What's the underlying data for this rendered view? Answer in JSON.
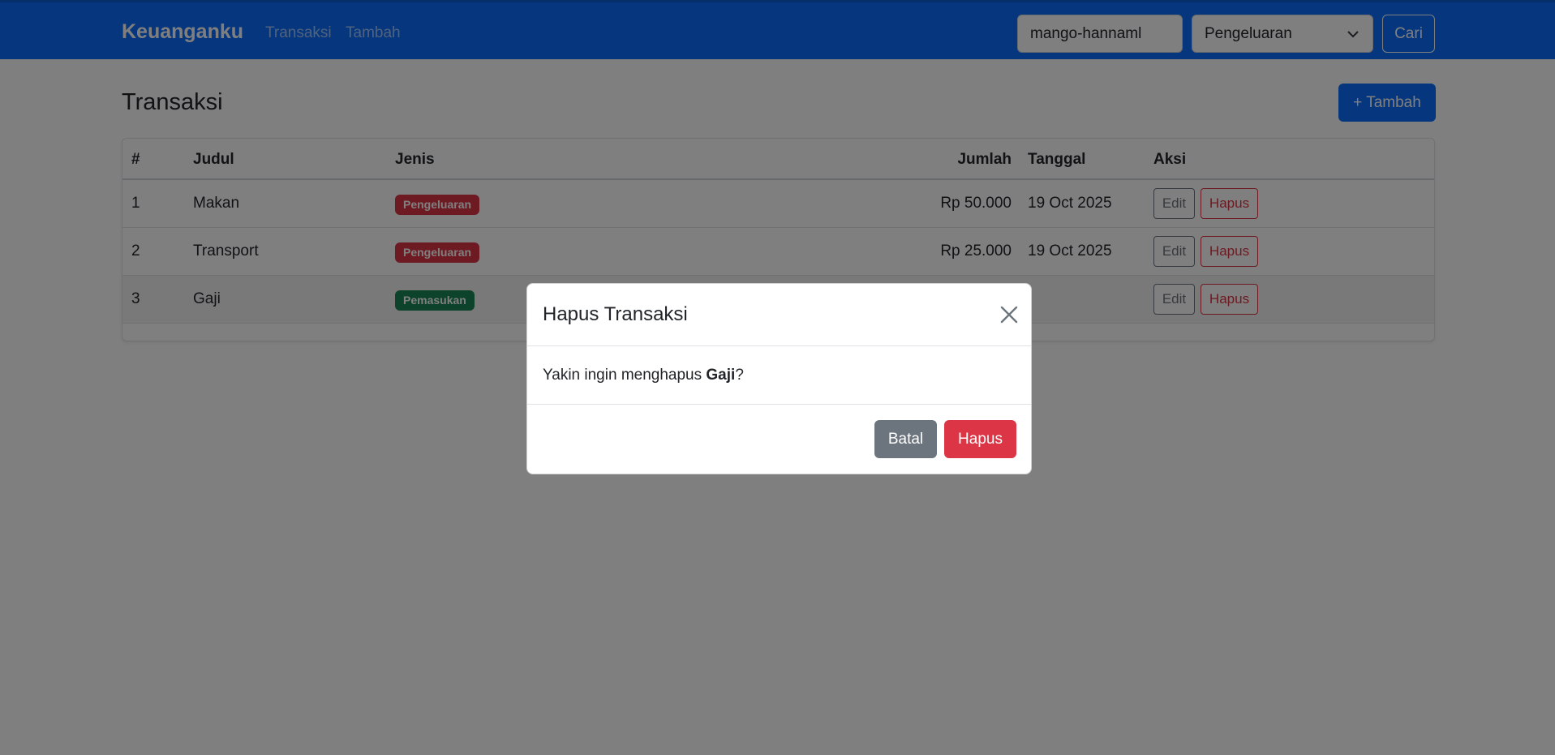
{
  "navbar": {
    "brand": "Keuanganku",
    "links": [
      "Transaksi",
      "Tambah"
    ],
    "search_value": "mango-hannaml",
    "filter_selected": "Pengeluaran",
    "search_button": "Cari",
    "chevron_icon": "chevron-down-icon"
  },
  "page": {
    "title": "Transaksi",
    "add_button": "+ Tambah"
  },
  "table": {
    "headers": [
      "#",
      "Judul",
      "Jenis",
      "Jumlah",
      "Tanggal",
      "Aksi"
    ],
    "rows": [
      {
        "no": "1",
        "judul": "Makan",
        "jenis": "Pengeluaran",
        "jumlah": "Rp 50.000",
        "tanggal": "19 Oct 2025",
        "edit": "Edit",
        "hapus": "Hapus"
      },
      {
        "no": "2",
        "judul": "Transport",
        "jenis": "Pengeluaran",
        "jumlah": "Rp 25.000",
        "tanggal": "19 Oct 2025",
        "edit": "Edit",
        "hapus": "Hapus"
      },
      {
        "no": "3",
        "judul": "Gaji",
        "jenis": "Pemasukan",
        "jumlah": "",
        "tanggal": "",
        "edit": "Edit",
        "hapus": "Hapus"
      }
    ]
  },
  "modal": {
    "title": "Hapus Transaksi",
    "close_icon": "close-icon",
    "body_prefix": "Yakin ingin menghapus ",
    "body_item": "Gaji",
    "body_suffix": "?",
    "cancel_button": "Batal",
    "confirm_button": "Hapus"
  },
  "colors": {
    "primary": "#0d6efd",
    "danger": "#dc3545",
    "success": "#198754",
    "secondary": "#6c757d"
  }
}
